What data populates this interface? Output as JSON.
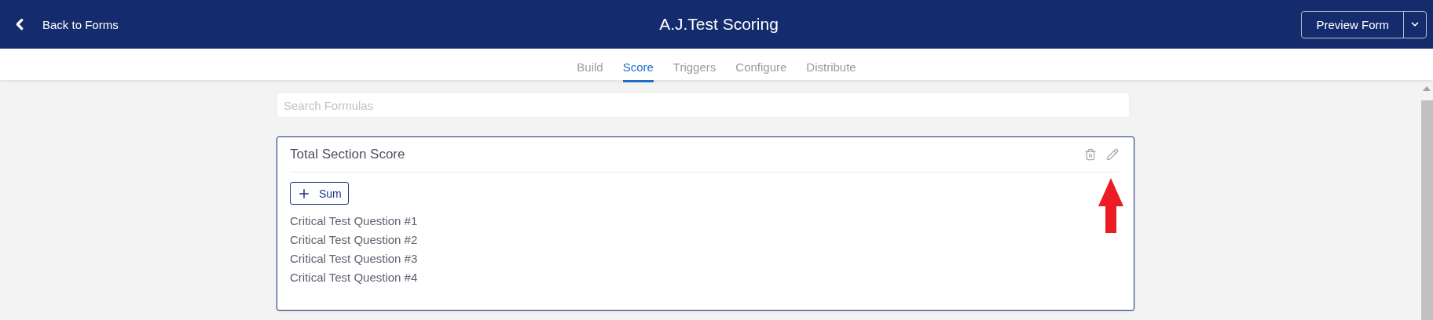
{
  "header": {
    "back_link": "Back to Forms",
    "title": "A.J.Test Scoring",
    "preview_button": "Preview Form"
  },
  "tabs": [
    {
      "label": "Build",
      "selected": false
    },
    {
      "label": "Score",
      "selected": true
    },
    {
      "label": "Triggers",
      "selected": false
    },
    {
      "label": "Configure",
      "selected": false
    },
    {
      "label": "Distribute",
      "selected": false
    }
  ],
  "search": {
    "placeholder": "Search Formulas"
  },
  "formula_card": {
    "title": "Total Section Score",
    "operation_button": "Sum",
    "items": [
      "Critical Test Question #1",
      "Critical Test Question #2",
      "Critical Test Question #3",
      "Critical Test Question #4"
    ]
  }
}
